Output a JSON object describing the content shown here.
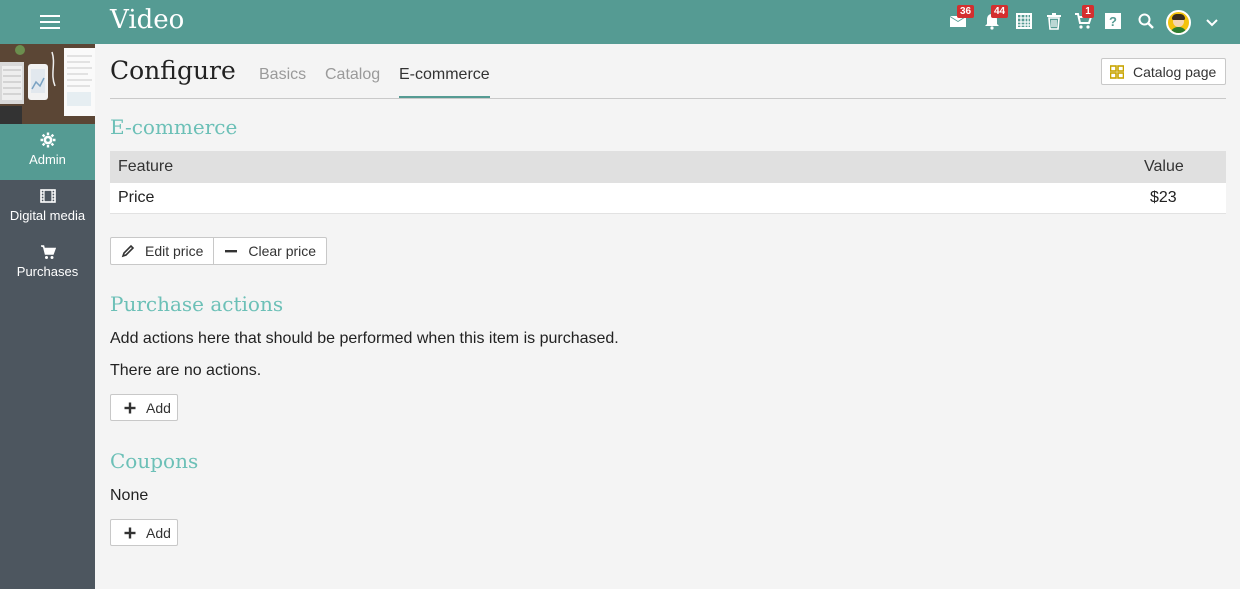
{
  "header": {
    "title": "Video",
    "menu_icon": "hamburger-icon",
    "icons": [
      {
        "name": "mail-icon",
        "badge": "36"
      },
      {
        "name": "bell-icon",
        "badge": "44"
      },
      {
        "name": "calendar-icon",
        "badge": ""
      },
      {
        "name": "trash-icon",
        "badge": ""
      },
      {
        "name": "cart-icon",
        "badge": "1"
      },
      {
        "name": "help-icon",
        "badge": ""
      },
      {
        "name": "search-icon",
        "badge": ""
      },
      {
        "name": "avatar",
        "badge": ""
      },
      {
        "name": "chevron-down-icon",
        "badge": ""
      }
    ],
    "colors": {
      "bar": "#559b93",
      "badge": "#d32f2f"
    }
  },
  "sidebar": {
    "items": [
      {
        "label": "Admin",
        "icon": "gear-icon",
        "active": true
      },
      {
        "label": "Digital media",
        "icon": "film-icon",
        "active": false
      },
      {
        "label": "Purchases",
        "icon": "cart-icon",
        "active": false
      }
    ]
  },
  "page": {
    "title": "Configure",
    "tabs": [
      {
        "label": "Basics",
        "active": false
      },
      {
        "label": "Catalog",
        "active": false
      },
      {
        "label": "E-commerce",
        "active": true
      }
    ],
    "catalog_button": "Catalog page"
  },
  "ecommerce": {
    "title": "E-commerce",
    "columns": [
      "Feature",
      "Value"
    ],
    "rows": [
      {
        "feature": "Price",
        "value": "$23"
      }
    ],
    "edit_price": "Edit price",
    "clear_price": "Clear price"
  },
  "purchase_actions": {
    "title": "Purchase actions",
    "description": "Add actions here that should be performed when this item is purchased.",
    "empty": "There are no actions.",
    "add": "Add"
  },
  "coupons": {
    "title": "Coupons",
    "empty": "None",
    "add": "Add"
  }
}
